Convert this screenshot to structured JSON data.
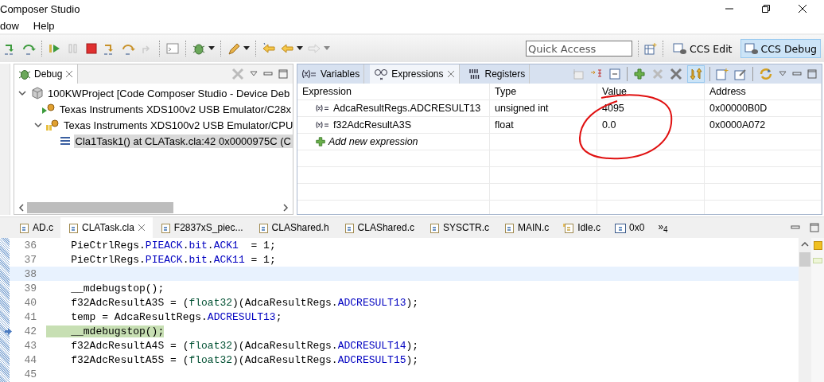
{
  "window": {
    "title": "Composer Studio"
  },
  "menu": [
    "dow",
    "Help"
  ],
  "quick_access": {
    "placeholder": "Quick Access"
  },
  "perspectives": [
    {
      "label": "CCS Edit",
      "selected": false
    },
    {
      "label": "CCS Debug",
      "selected": true
    }
  ],
  "debug_view": {
    "tab": {
      "label": "Debug",
      "selected": true
    },
    "tree": [
      {
        "kind": "project",
        "label": "100KWProject [Code Composer Studio - Device Deb",
        "expanded": true,
        "selected": false,
        "children": [
          {
            "kind": "core-running",
            "label": "Texas Instruments XDS100v2 USB Emulator/C28x",
            "selected": false
          },
          {
            "kind": "core-suspended",
            "label": "Texas Instruments XDS100v2 USB Emulator/CPU",
            "expanded": true,
            "selected": false,
            "children": [
              {
                "kind": "frame",
                "label": "Cla1Task1() at CLATask.cla:42 0x0000975C  (C",
                "selected": true
              }
            ]
          }
        ]
      }
    ]
  },
  "expressions_view": {
    "tabs": [
      {
        "label": "Variables",
        "kind": "variables",
        "selected": false
      },
      {
        "label": "Expressions",
        "kind": "expressions",
        "selected": true
      },
      {
        "label": "Registers",
        "kind": "registers",
        "selected": false
      }
    ],
    "columns": [
      "Expression",
      "Type",
      "Value",
      "Address"
    ],
    "rows": [
      {
        "expression": "AdcaResultRegs.ADCRESULT13",
        "type": "unsigned int",
        "value": "4095",
        "address": "0x00000B0D"
      },
      {
        "expression": "f32AdcResultA3S",
        "type": "float",
        "value": "0.0",
        "address": "0x0000A072"
      }
    ],
    "add_row": "Add new expression"
  },
  "editor": {
    "tabs": [
      {
        "label": "AD.c",
        "kind": "c",
        "selected": false
      },
      {
        "label": "CLATask.cla",
        "kind": "c",
        "selected": true
      },
      {
        "label": "F2837xS_piec...",
        "kind": "h",
        "selected": false
      },
      {
        "label": "CLAShared.h",
        "kind": "h",
        "selected": false
      },
      {
        "label": "CLAShared.c",
        "kind": "c",
        "selected": false
      },
      {
        "label": "SYSCTR.c",
        "kind": "c",
        "selected": false
      },
      {
        "label": "MAIN.c",
        "kind": "c",
        "selected": false
      },
      {
        "label": "Idle.c",
        "kind": "folder-c",
        "selected": false
      },
      {
        "label": "0x0",
        "kind": "disassembly",
        "selected": false
      }
    ],
    "overflow": "»$_{4}$",
    "lines": [
      {
        "number": "36",
        "cursor_line": false,
        "debug_pointer": false,
        "tokens": [
          {
            "text": "    PieCtrlRegs.",
            "kind": "plain"
          },
          {
            "text": "PIEACK",
            "kind": "field"
          },
          {
            "text": ".",
            "kind": "plain"
          },
          {
            "text": "bit",
            "kind": "field"
          },
          {
            "text": ".",
            "kind": "plain"
          },
          {
            "text": "ACK1",
            "kind": "field"
          },
          {
            "text": "  = 1;",
            "kind": "plain"
          }
        ]
      },
      {
        "number": "37",
        "cursor_line": false,
        "debug_pointer": false,
        "tokens": [
          {
            "text": "    PieCtrlRegs.",
            "kind": "plain"
          },
          {
            "text": "PIEACK",
            "kind": "field"
          },
          {
            "text": ".",
            "kind": "plain"
          },
          {
            "text": "bit",
            "kind": "field"
          },
          {
            "text": ".",
            "kind": "plain"
          },
          {
            "text": "ACK11",
            "kind": "field"
          },
          {
            "text": " = 1;",
            "kind": "plain"
          }
        ]
      },
      {
        "number": "38",
        "cursor_line": true,
        "debug_pointer": false
      },
      {
        "number": "39",
        "cursor_line": false,
        "debug_pointer": false,
        "tokens": [
          {
            "text": "    __mdebugstop();",
            "kind": "plain"
          }
        ]
      },
      {
        "number": "40",
        "cursor_line": false,
        "debug_pointer": false,
        "tokens": [
          {
            "text": "    f32AdcResultA3S = (",
            "kind": "plain"
          },
          {
            "text": "float32",
            "kind": "type"
          },
          {
            "text": ")(AdcaResultRegs.",
            "kind": "plain"
          },
          {
            "text": "ADCRESULT13",
            "kind": "field"
          },
          {
            "text": ");",
            "kind": "plain"
          }
        ]
      },
      {
        "number": "41",
        "cursor_line": false,
        "debug_pointer": false,
        "tokens": [
          {
            "text": "    temp = AdcaResultRegs.",
            "kind": "plain"
          },
          {
            "text": "ADCRESULT13",
            "kind": "field"
          },
          {
            "text": ";",
            "kind": "plain"
          }
        ]
      },
      {
        "number": "42",
        "cursor_line": false,
        "debug_pointer": true,
        "tokens": [
          {
            "text": "    __mdebugstop();",
            "kind": "plain"
          }
        ]
      },
      {
        "number": "43",
        "cursor_line": false,
        "debug_pointer": false,
        "tokens": [
          {
            "text": "    f32AdcResultA4S = (",
            "kind": "plain"
          },
          {
            "text": "float32",
            "kind": "type"
          },
          {
            "text": ")(AdcaResultRegs.",
            "kind": "plain"
          },
          {
            "text": "ADCRESULT14",
            "kind": "field"
          },
          {
            "text": ");",
            "kind": "plain"
          }
        ]
      },
      {
        "number": "44",
        "cursor_line": false,
        "debug_pointer": false,
        "tokens": [
          {
            "text": "    f32AdcResultA5S = (",
            "kind": "plain"
          },
          {
            "text": "float32",
            "kind": "type"
          },
          {
            "text": ")(AdcaResultRegs.",
            "kind": "plain"
          },
          {
            "text": "ADCRESULT15",
            "kind": "field"
          },
          {
            "text": ");",
            "kind": "plain"
          }
        ]
      },
      {
        "number": "45",
        "cursor_line": false,
        "debug_pointer": false
      }
    ]
  }
}
